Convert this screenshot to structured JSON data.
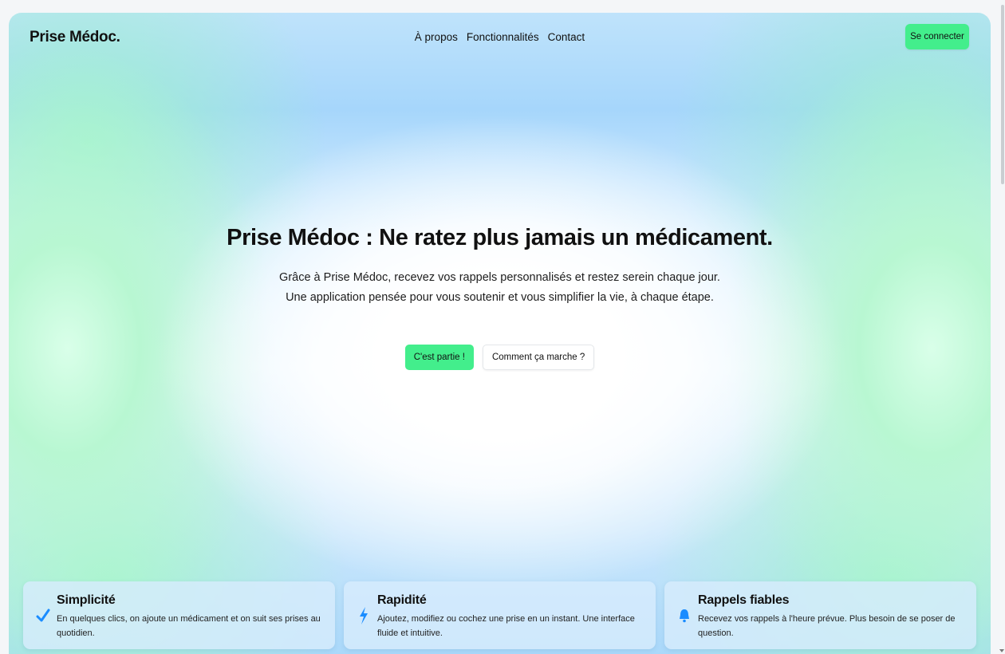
{
  "header": {
    "logo": "Prise Médoc.",
    "nav": [
      "À propos",
      "Fonctionnalités",
      "Contact"
    ],
    "login_label": "Se connecter"
  },
  "hero": {
    "title": "Prise Médoc : Ne ratez plus jamais un médicament.",
    "subtitle_line1": "Grâce à Prise Médoc, recevez vos rappels personnalisés et restez serein chaque jour.",
    "subtitle_line2": "Une application pensée pour vous soutenir et vous simplifier la vie, à chaque étape.",
    "primary_label": "C'est partie !",
    "secondary_label": "Comment ça marche ?"
  },
  "features": [
    {
      "icon": "checkmark-icon",
      "title": "Simplicité",
      "description": "En quelques clics, on ajoute un médicament et on suit ses prises au quotidien."
    },
    {
      "icon": "lightning-icon",
      "title": "Rapidité",
      "description": "Ajoutez, modifiez ou cochez une prise en un instant. Une interface fluide et intuitive."
    },
    {
      "icon": "bell-icon",
      "title": "Rappels fiables",
      "description": "Recevez vos rappels à l'heure prévue. Plus besoin de se poser de question."
    }
  ],
  "colors": {
    "accent_green": "#43ee8c",
    "icon_blue": "#1a8cff"
  }
}
